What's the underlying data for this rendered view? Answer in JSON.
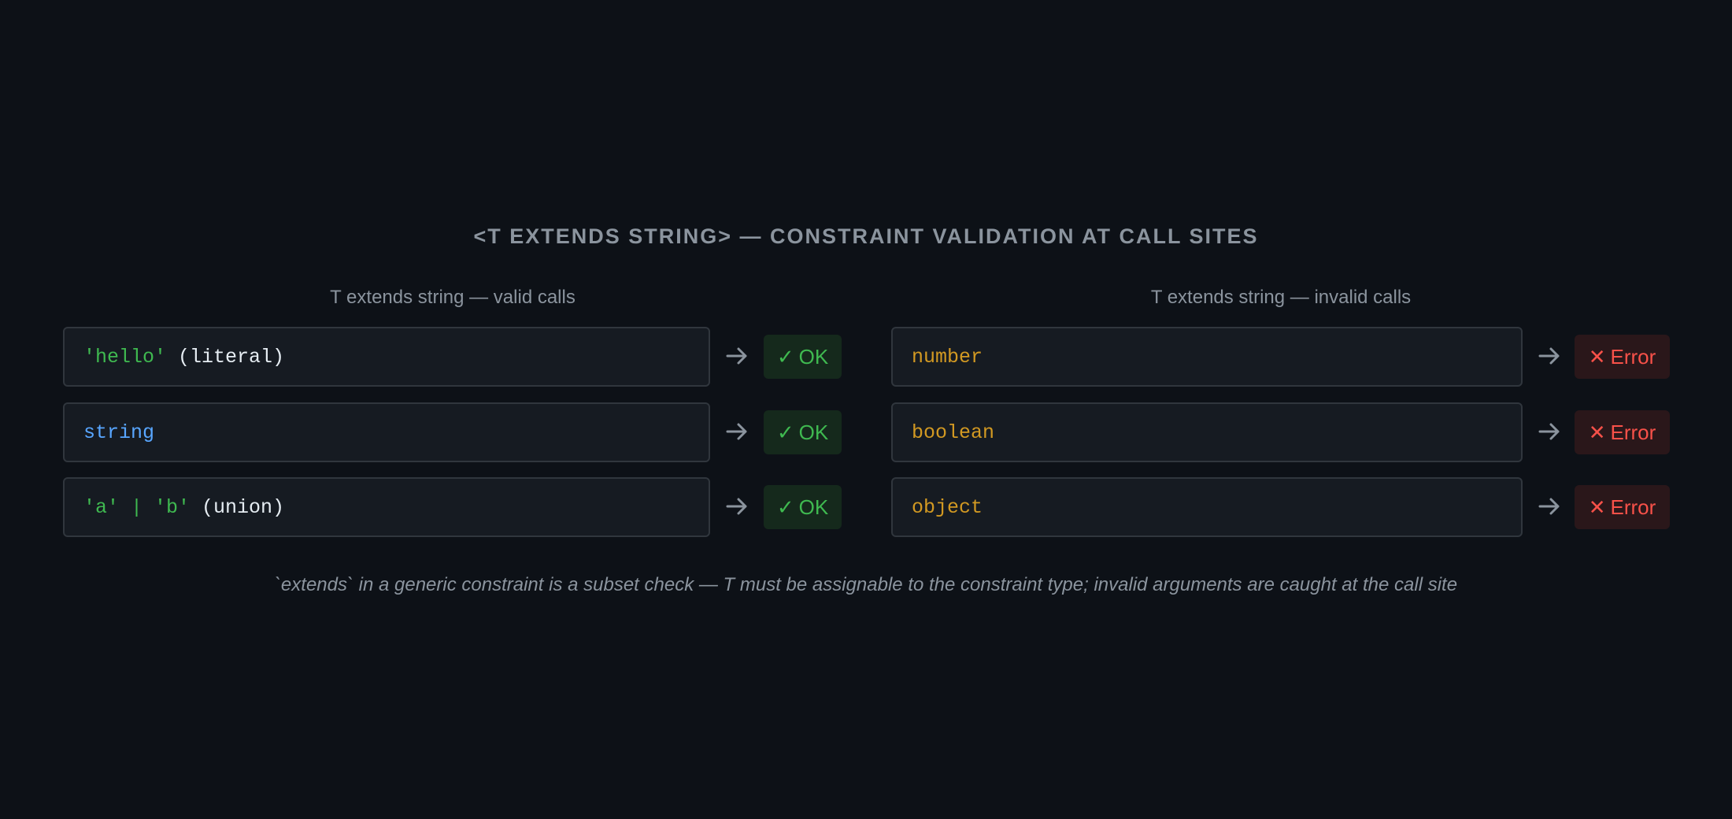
{
  "title": "<T EXTENDS STRING> — CONSTRAINT VALIDATION AT CALL SITES",
  "left_column": {
    "heading": "T extends string — valid calls",
    "rows": [
      {
        "parts": [
          {
            "text": "'hello'",
            "kind": "str"
          },
          {
            "text": " (literal)",
            "kind": "plain"
          }
        ],
        "badge_mark": "✓",
        "badge_label": "OK"
      },
      {
        "parts": [
          {
            "text": "string",
            "kind": "kw"
          }
        ],
        "badge_mark": "✓",
        "badge_label": "OK"
      },
      {
        "parts": [
          {
            "text": "'a' | 'b'",
            "kind": "str"
          },
          {
            "text": " (union)",
            "kind": "plain"
          }
        ],
        "badge_mark": "✓",
        "badge_label": "OK"
      }
    ]
  },
  "right_column": {
    "heading": "T extends string — invalid calls",
    "rows": [
      {
        "parts": [
          {
            "text": "number",
            "kind": "bad"
          }
        ],
        "badge_mark": "✕",
        "badge_label": "Error"
      },
      {
        "parts": [
          {
            "text": "boolean",
            "kind": "bad"
          }
        ],
        "badge_mark": "✕",
        "badge_label": "Error"
      },
      {
        "parts": [
          {
            "text": "object",
            "kind": "bad"
          }
        ],
        "badge_mark": "✕",
        "badge_label": "Error"
      }
    ]
  },
  "footnote": "`extends` in a generic constraint is a subset check — T must be assignable to the constraint type; invalid arguments are caught at the call site",
  "colors": {
    "background": "#0d1117",
    "ok": "#3fb950",
    "error": "#f85149",
    "string_literal": "#3fb950",
    "type_keyword": "#58a6ff",
    "invalid_type": "#d29922",
    "arrow_icon": "arrow-right-icon"
  }
}
